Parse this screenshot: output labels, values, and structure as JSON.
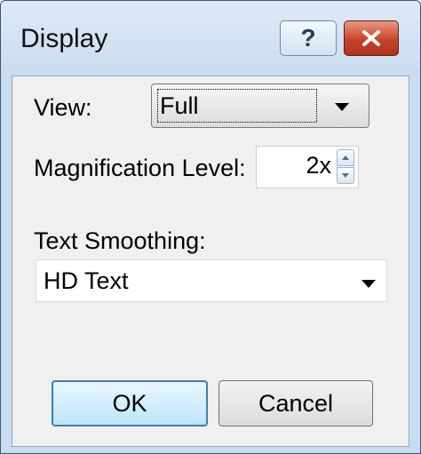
{
  "window": {
    "title": "Display",
    "help_glyph": "?",
    "close_icon": "close-icon"
  },
  "view": {
    "label": "View:",
    "selected": "Full"
  },
  "magnification": {
    "label": "Magnification Level:",
    "value": "2x"
  },
  "text_smoothing": {
    "label": "Text Smoothing:",
    "selected": "HD Text"
  },
  "buttons": {
    "ok_label": "OK",
    "cancel_label": "Cancel"
  },
  "colors": {
    "frame": "#c9ddf0",
    "close_button": "#c6432b",
    "default_button_border": "#3c7fb1"
  }
}
